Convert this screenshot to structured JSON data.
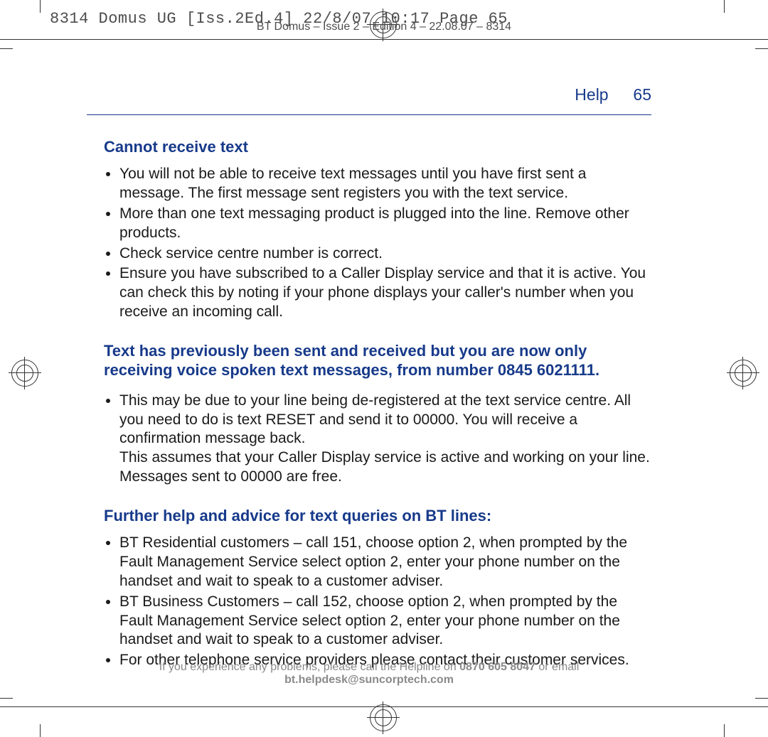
{
  "slug": "8314 Domus UG [Iss.2Ed.4]  22/8/07  10:17  Page 65",
  "slug2": "BT Domus – Issue 2 – Edition 4 – 22.08.07 – 8314",
  "runhead": {
    "label": "Help",
    "page": "65"
  },
  "sec1": {
    "title": "Cannot receive text",
    "items": [
      "You will not be able to receive text messages until you have first sent a message. The first message sent registers you with the text service.",
      "More than one text messaging product is plugged into the line. Remove other products.",
      "Check service centre number is correct.",
      "Ensure you have subscribed to a Caller Display service and that it is active. You can check this by noting if your phone displays your caller's number when you receive an incoming call."
    ]
  },
  "sec2": {
    "title": "Text has previously been sent and received but you are now only receiving voice spoken text messages, from number 0845 6021111.",
    "bullet": "This may be due to your line being de-registered at the text service centre. All you need to do is text RESET and send it to 00000. You will receive a confirmation message back.",
    "cont": "This assumes that your Caller Display service is active and working on your line. Messages sent to 00000 are free."
  },
  "sec3": {
    "title": "Further help and advice for text queries on BT lines:",
    "items": [
      "BT Residential customers – call 151, choose option 2, when prompted by the Fault Management Service select option 2, enter your phone number on the handset and wait to speak to a customer adviser.",
      "BT Business Customers – call 152, choose option 2, when prompted by the Fault Management Service select option 2, enter your phone number on the handset and wait to speak to a customer adviser.",
      "For other telephone service providers please contact their customer services."
    ]
  },
  "footer": {
    "pre": "If you experience any problems, please call the Helpline on ",
    "phone": "0870 605 8047",
    "mid": " or email ",
    "email": "bt.helpdesk@suncorptech.com"
  }
}
